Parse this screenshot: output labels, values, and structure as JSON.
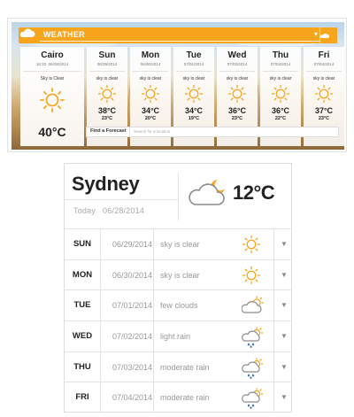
{
  "top_widget": {
    "bar_title": "WEATHER",
    "current": {
      "city": "Cairo",
      "time": "16:33",
      "date": "06/28/2014",
      "condition": "Sky is Clear",
      "temp": "40°C"
    },
    "days": [
      {
        "name": "Sun",
        "date": "06/29/2014",
        "condition": "sky is clear",
        "hi": "38°C",
        "lo": "23°C"
      },
      {
        "name": "Mon",
        "date": "06/30/2014",
        "condition": "sky is clear",
        "hi": "34°C",
        "lo": "20°C"
      },
      {
        "name": "Tue",
        "date": "07/01/2014",
        "condition": "sky is clear",
        "hi": "34°C",
        "lo": "19°C"
      },
      {
        "name": "Wed",
        "date": "07/02/2014",
        "condition": "sky is clear",
        "hi": "36°C",
        "lo": "23°C"
      },
      {
        "name": "Thu",
        "date": "07/03/2014",
        "condition": "sky is clear",
        "hi": "36°C",
        "lo": "22°C"
      },
      {
        "name": "Fri",
        "date": "07/04/2014",
        "condition": "sky is clear",
        "hi": "37°C",
        "lo": "23°C"
      }
    ],
    "forecast_label": "Find a Forecast",
    "forecast_placeholder": "Search for a location"
  },
  "bottom_widget": {
    "city": "Sydney",
    "today_label": "Today",
    "today_date": "06/28/2014",
    "current_temp": "12°C",
    "current_icon": "cloud-moon-icon",
    "rows": [
      {
        "day": "SUN",
        "date": "06/29/2014",
        "desc": "sky is clear",
        "icon": "sun-icon"
      },
      {
        "day": "MON",
        "date": "06/30/2014",
        "desc": "sky is clear",
        "icon": "sun-icon"
      },
      {
        "day": "TUE",
        "date": "07/01/2014",
        "desc": "few clouds",
        "icon": "cloud-sun-icon"
      },
      {
        "day": "WED",
        "date": "07/02/2014",
        "desc": "light rain",
        "icon": "rain-icon"
      },
      {
        "day": "THU",
        "date": "07/03/2014",
        "desc": "moderate rain",
        "icon": "rain-icon"
      },
      {
        "day": "FRI",
        "date": "07/04/2014",
        "desc": "moderate rain",
        "icon": "rain-icon"
      }
    ]
  },
  "colors": {
    "accent": "#f7a51c",
    "sun": "#f5a623",
    "cloud_outline": "#8c8c8c",
    "rain": "#2f6fb5"
  }
}
